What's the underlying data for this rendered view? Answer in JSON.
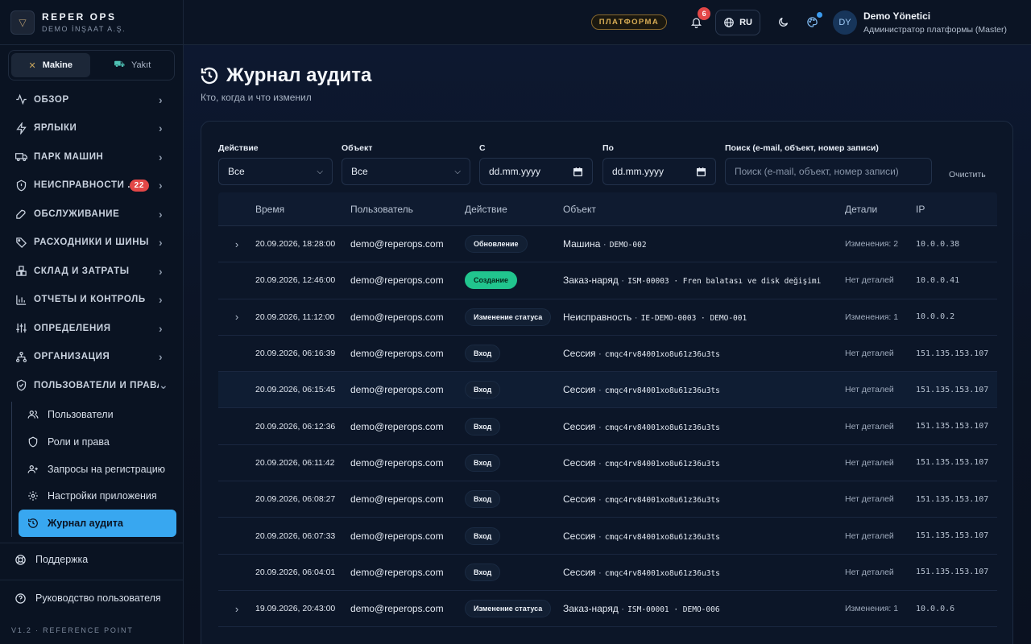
{
  "brand": {
    "name": "REPER OPS",
    "subtitle": "DEMO İNŞAAT A.Ş."
  },
  "mode_toggle": [
    {
      "label": "Makine",
      "active": true,
      "icon": "crane-icon"
    },
    {
      "label": "Yakıt",
      "active": false,
      "icon": "fuel-icon"
    }
  ],
  "nav": [
    {
      "label": "ОБЗОР",
      "icon": "activity-icon"
    },
    {
      "label": "ЯРЛЫКИ",
      "icon": "bolt-icon"
    },
    {
      "label": "ПАРК МАШИН",
      "icon": "truck-icon"
    },
    {
      "label": "НЕИСПРАВНОСТИ ...",
      "icon": "alert-shield-icon",
      "badge": "22"
    },
    {
      "label": "ОБСЛУЖИВАНИЕ",
      "icon": "wrench-icon"
    },
    {
      "label": "РАСХОДНИКИ И ШИНЫ",
      "icon": "tag-icon"
    },
    {
      "label": "СКЛАД И ЗАТРАТЫ",
      "icon": "boxes-icon"
    },
    {
      "label": "ОТЧЁТЫ И КОНТРОЛЬ",
      "icon": "chart-icon"
    },
    {
      "label": "ОПРЕДЕЛЕНИЯ",
      "icon": "sliders-icon"
    },
    {
      "label": "ОРГАНИЗАЦИЯ",
      "icon": "network-icon"
    },
    {
      "label": "ПОЛЬЗОВАТЕЛИ И ПРАВА",
      "icon": "shield-check-icon",
      "expanded": true
    }
  ],
  "subnav": [
    {
      "label": "Пользователи",
      "icon": "users-icon"
    },
    {
      "label": "Роли и права",
      "icon": "shield-icon"
    },
    {
      "label": "Запросы на регистрацию",
      "icon": "user-plus-icon"
    },
    {
      "label": "Настройки приложения",
      "icon": "gear-icon"
    },
    {
      "label": "Журнал аудита",
      "icon": "history-icon",
      "active": true
    }
  ],
  "support_label": "Поддержка",
  "guide_label": "Руководство пользователя",
  "version": "V1.2 · REFERENCE POINT",
  "topbar": {
    "platform_label": "ПЛАТФОРМА",
    "notifications_count": "6",
    "language": "RU",
    "user_initials": "DY",
    "user_name": "Demo Yönetici",
    "user_role": "Администратор платформы (Master)"
  },
  "page": {
    "title": "Журнал аудита",
    "subtitle": "Кто, когда и что изменил"
  },
  "filters": {
    "action_label": "Действие",
    "action_value": "Все",
    "object_label": "Объект",
    "object_value": "Все",
    "from_label": "С",
    "from_placeholder": "dd.mm.yyyy",
    "to_label": "По",
    "to_placeholder": "dd.mm.yyyy",
    "search_label": "Поиск (e-mail, объект, номер записи)",
    "search_placeholder": "Поиск (e-mail, объект, номер записи)",
    "clear_label": "Очистить"
  },
  "table": {
    "columns": [
      "Время",
      "Пользователь",
      "Действие",
      "Объект",
      "Детали",
      "IP"
    ],
    "rows": [
      {
        "expandable": true,
        "time": "20.09.2026, 18:28:00",
        "user": "demo@reperops.com",
        "action": "Обновление",
        "action_style": "default",
        "object": "Машина",
        "ref": "DEMO-002",
        "details": "Изменения: 2",
        "ip": "10.0.0.38"
      },
      {
        "expandable": false,
        "time": "20.09.2026, 12:46:00",
        "user": "demo@reperops.com",
        "action": "Создание",
        "action_style": "green",
        "object": "Заказ-наряд",
        "ref": "ISM-00003 · Fren balatası ve disk değişimi",
        "details": "Нет деталей",
        "ip": "10.0.0.41"
      },
      {
        "expandable": true,
        "time": "20.09.2026, 11:12:00",
        "user": "demo@reperops.com",
        "action": "Изменение статуса",
        "action_style": "default",
        "object": "Неисправность",
        "ref": "IE-DEMO-0003 · DEMO-001",
        "details": "Изменения: 1",
        "ip": "10.0.0.2"
      },
      {
        "expandable": false,
        "time": "20.09.2026, 06:16:39",
        "user": "demo@reperops.com",
        "action": "Вход",
        "action_style": "default",
        "object": "Сессия",
        "ref": "cmqc4rv84001xo8u61z36u3ts",
        "details": "Нет деталей",
        "ip": "151.135.153.107"
      },
      {
        "expandable": false,
        "time": "20.09.2026, 06:15:45",
        "user": "demo@reperops.com",
        "action": "Вход",
        "action_style": "default",
        "object": "Сессия",
        "ref": "cmqc4rv84001xo8u61z36u3ts",
        "details": "Нет деталей",
        "ip": "151.135.153.107",
        "highlight": true
      },
      {
        "expandable": false,
        "time": "20.09.2026, 06:12:36",
        "user": "demo@reperops.com",
        "action": "Вход",
        "action_style": "default",
        "object": "Сессия",
        "ref": "cmqc4rv84001xo8u61z36u3ts",
        "details": "Нет деталей",
        "ip": "151.135.153.107"
      },
      {
        "expandable": false,
        "time": "20.09.2026, 06:11:42",
        "user": "demo@reperops.com",
        "action": "Вход",
        "action_style": "default",
        "object": "Сессия",
        "ref": "cmqc4rv84001xo8u61z36u3ts",
        "details": "Нет деталей",
        "ip": "151.135.153.107"
      },
      {
        "expandable": false,
        "time": "20.09.2026, 06:08:27",
        "user": "demo@reperops.com",
        "action": "Вход",
        "action_style": "default",
        "object": "Сессия",
        "ref": "cmqc4rv84001xo8u61z36u3ts",
        "details": "Нет деталей",
        "ip": "151.135.153.107"
      },
      {
        "expandable": false,
        "time": "20.09.2026, 06:07:33",
        "user": "demo@reperops.com",
        "action": "Вход",
        "action_style": "default",
        "object": "Сессия",
        "ref": "cmqc4rv84001xo8u61z36u3ts",
        "details": "Нет деталей",
        "ip": "151.135.153.107"
      },
      {
        "expandable": false,
        "time": "20.09.2026, 06:04:01",
        "user": "demo@reperops.com",
        "action": "Вход",
        "action_style": "default",
        "object": "Сессия",
        "ref": "cmqc4rv84001xo8u61z36u3ts",
        "details": "Нет деталей",
        "ip": "151.135.153.107"
      },
      {
        "expandable": true,
        "time": "19.09.2026, 20:43:00",
        "user": "demo@reperops.com",
        "action": "Изменение статуса",
        "action_style": "default",
        "object": "Заказ-наряд",
        "ref": "ISM-00001 · DEMO-006",
        "details": "Изменения: 1",
        "ip": "10.0.0.6"
      }
    ]
  },
  "colors": {
    "accent": "#38a7f0",
    "danger": "#e34747",
    "success": "#21c58e",
    "platform": "#d8ad55"
  }
}
